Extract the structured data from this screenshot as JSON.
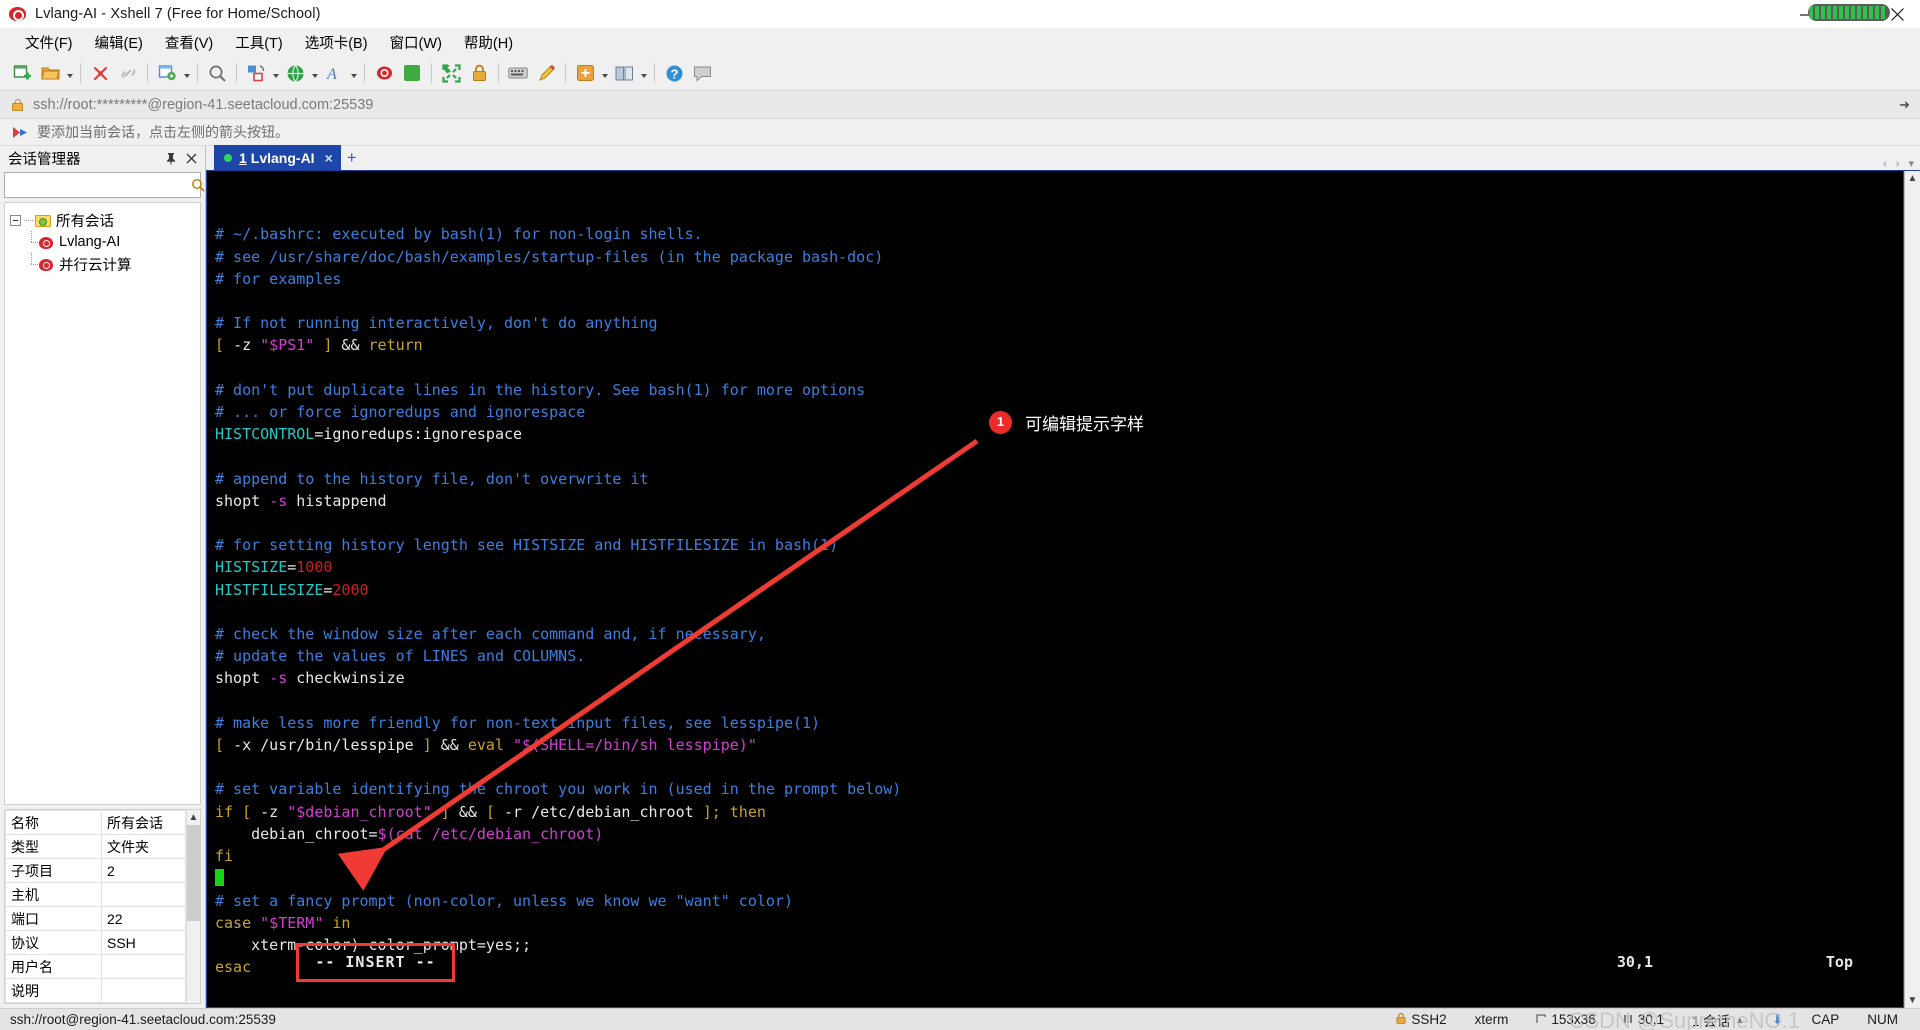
{
  "window": {
    "title": "Lvlang-AI - Xshell 7 (Free for Home/School)",
    "icon": "snail-icon",
    "minimize": "minimize-button",
    "restore": "restore-button",
    "close": "close-button"
  },
  "menubar": {
    "items": [
      "文件(F)",
      "编辑(E)",
      "查看(V)",
      "工具(T)",
      "选项卡(B)",
      "窗口(W)",
      "帮助(H)"
    ]
  },
  "toolbar": {
    "icons": [
      "new-session-icon",
      "open-folder-icon",
      "disconnect-icon",
      "link-icon",
      "properties-icon",
      "find-icon",
      "transfer-icon",
      "globe-icon",
      "font-icon",
      "xshell-icon",
      "xftp-icon",
      "fullscreen-icon",
      "lock-icon",
      "keyboard-icon",
      "compose-icon",
      "add-tab-icon",
      "layout-icon",
      "help-icon",
      "chat-icon"
    ]
  },
  "addressbar": {
    "icon": "lock-icon",
    "value": "ssh://root:*********@region-41.seetacloud.com:25539",
    "expand": "expand-arrow-icon"
  },
  "hintbar": {
    "icon": "red-arrow-icon",
    "text": "要添加当前会话，点击左侧的箭头按钮。"
  },
  "session_manager": {
    "title": "会话管理器",
    "pin": "pin-icon",
    "close": "close-icon",
    "search_placeholder": "",
    "search_value": "",
    "search_icon": "search-icon",
    "tree": [
      {
        "label": "所有会话",
        "icon": "folder-icon",
        "level": 0,
        "expanded": true
      },
      {
        "label": "Lvlang-AI",
        "icon": "snail-icon",
        "level": 1
      },
      {
        "label": "并行云计算",
        "icon": "snail-icon",
        "level": 1
      }
    ],
    "properties": [
      {
        "key": "名称",
        "value": "所有会话"
      },
      {
        "key": "类型",
        "value": "文件夹"
      },
      {
        "key": "子项目",
        "value": "2"
      },
      {
        "key": "主机",
        "value": ""
      },
      {
        "key": "端口",
        "value": "22"
      },
      {
        "key": "协议",
        "value": "SSH"
      },
      {
        "key": "用户名",
        "value": ""
      },
      {
        "key": "说明",
        "value": ""
      }
    ]
  },
  "tabs": {
    "items": [
      {
        "index": "1",
        "label": "Lvlang-AI",
        "status_dot": "#2fd85a",
        "close": "×"
      }
    ],
    "new_tab": "+",
    "nav_prev": "‹",
    "nav_next": "›",
    "nav_menu": "▾"
  },
  "terminal": {
    "lines": [
      [
        {
          "t": "# ~/.bashrc: executed by bash(1) for non-login shells.",
          "c": "c-blue"
        }
      ],
      [
        {
          "t": "# see /usr/share/doc/bash/examples/startup-files (in the package bash-doc)",
          "c": "c-blue"
        }
      ],
      [
        {
          "t": "# for examples",
          "c": "c-blue"
        }
      ],
      [],
      [
        {
          "t": "# If not running interactively, don't do anything",
          "c": "c-blue"
        }
      ],
      [
        {
          "t": "[ ",
          "c": "c-yellow"
        },
        {
          "t": "-z ",
          "c": "c-white"
        },
        {
          "t": "\"$PS1\"",
          "c": "c-magenta"
        },
        {
          "t": " ]",
          "c": "c-yellow"
        },
        {
          "t": " && ",
          "c": "c-white"
        },
        {
          "t": "return",
          "c": "c-yellow"
        }
      ],
      [],
      [
        {
          "t": "# don't put duplicate lines in the history. See bash(1) for more options",
          "c": "c-blue"
        }
      ],
      [
        {
          "t": "# ... or force ignoredups and ignorespace",
          "c": "c-blue"
        }
      ],
      [
        {
          "t": "HISTCONTROL",
          "c": "c-cyan"
        },
        {
          "t": "=ignoredups:ignorespace",
          "c": "c-white"
        }
      ],
      [],
      [
        {
          "t": "# append to the history file, don't overwrite it",
          "c": "c-blue"
        }
      ],
      [
        {
          "t": "shopt ",
          "c": "c-white"
        },
        {
          "t": "-s",
          "c": "c-magenta"
        },
        {
          "t": " histappend",
          "c": "c-white"
        }
      ],
      [],
      [
        {
          "t": "# for setting history length see HISTSIZE and HISTFILESIZE in bash(1)",
          "c": "c-blue"
        }
      ],
      [
        {
          "t": "HISTSIZE",
          "c": "c-cyan"
        },
        {
          "t": "=",
          "c": "c-white"
        },
        {
          "t": "1000",
          "c": "c-red"
        }
      ],
      [
        {
          "t": "HISTFILESIZE",
          "c": "c-cyan"
        },
        {
          "t": "=",
          "c": "c-white"
        },
        {
          "t": "2000",
          "c": "c-red"
        }
      ],
      [],
      [
        {
          "t": "# check the window size after each command and, if necessary,",
          "c": "c-blue"
        }
      ],
      [
        {
          "t": "# update the values of LINES and COLUMNS.",
          "c": "c-blue"
        }
      ],
      [
        {
          "t": "shopt ",
          "c": "c-white"
        },
        {
          "t": "-s",
          "c": "c-magenta"
        },
        {
          "t": " checkwinsize",
          "c": "c-white"
        }
      ],
      [],
      [
        {
          "t": "# make less more friendly for non-text input files, see lesspipe(1)",
          "c": "c-blue"
        }
      ],
      [
        {
          "t": "[ ",
          "c": "c-yellow"
        },
        {
          "t": "-x /usr/bin/lesspipe ",
          "c": "c-white"
        },
        {
          "t": "]",
          "c": "c-yellow"
        },
        {
          "t": " && ",
          "c": "c-white"
        },
        {
          "t": "eval ",
          "c": "c-yellow"
        },
        {
          "t": "\"",
          "c": "c-magenta"
        },
        {
          "t": "$(SHELL=/bin/sh lesspipe)",
          "c": "c-magenta"
        },
        {
          "t": "\"",
          "c": "c-magenta"
        }
      ],
      [],
      [
        {
          "t": "# set variable identifying the chroot you work in (used in the prompt below)",
          "c": "c-blue"
        }
      ],
      [
        {
          "t": "if ",
          "c": "c-yellow"
        },
        {
          "t": "[ ",
          "c": "c-yellow"
        },
        {
          "t": "-z ",
          "c": "c-white"
        },
        {
          "t": "\"$debian_chroot\"",
          "c": "c-magenta"
        },
        {
          "t": " ]",
          "c": "c-yellow"
        },
        {
          "t": " && ",
          "c": "c-white"
        },
        {
          "t": "[ ",
          "c": "c-yellow"
        },
        {
          "t": "-r /etc/debian_chroot ",
          "c": "c-white"
        },
        {
          "t": "]; ",
          "c": "c-yellow"
        },
        {
          "t": "then",
          "c": "c-yellow"
        }
      ],
      [
        {
          "t": "    debian_chroot",
          "c": "c-white"
        },
        {
          "t": "=",
          "c": "c-white"
        },
        {
          "t": "$(cat /etc/debian_chroot)",
          "c": "c-magenta"
        }
      ],
      [
        {
          "t": "fi",
          "c": "c-yellow"
        }
      ],
      [
        {
          "t": "__CURSOR__",
          "c": "cursor"
        }
      ],
      [
        {
          "t": "# set a fancy prompt (non-color, unless we know we \"want\" color)",
          "c": "c-blue"
        }
      ],
      [
        {
          "t": "case ",
          "c": "c-yellow"
        },
        {
          "t": "\"$TERM\"",
          "c": "c-magenta"
        },
        {
          "t": " in",
          "c": "c-yellow"
        }
      ],
      [
        {
          "t": "    xterm-color)",
          "c": "c-white"
        },
        {
          "t": " color_prompt",
          "c": "c-white"
        },
        {
          "t": "=yes;;",
          "c": "c-white"
        }
      ],
      [
        {
          "t": "esac",
          "c": "c-yellow"
        }
      ]
    ],
    "mode_line": "-- INSERT --",
    "cursor_pos": "30,1",
    "scroll_pos": "Top",
    "scroll_up": "▲",
    "scroll_down": "▼"
  },
  "annotation": {
    "badge": "1",
    "text": "可编辑提示字样",
    "arrow_color": "#ef3b34",
    "highlight_color": "#ef3b34"
  },
  "statusbar": {
    "connection": "ssh://root@region-41.seetacloud.com:25539",
    "security": "SSH2",
    "security_icon": "lock-icon",
    "terminal_type": "xterm",
    "size": "153x36",
    "size_icon": "resize-icon",
    "cursor": "30,1",
    "cursor_icon": "cursor-icon",
    "sessions": "1 会话",
    "up_icon": "arrow-up-icon",
    "down_icon": "arrow-down-icon",
    "cap": "CAP",
    "num": "NUM",
    "watermark": "CSDN @SupremeNO.1"
  }
}
